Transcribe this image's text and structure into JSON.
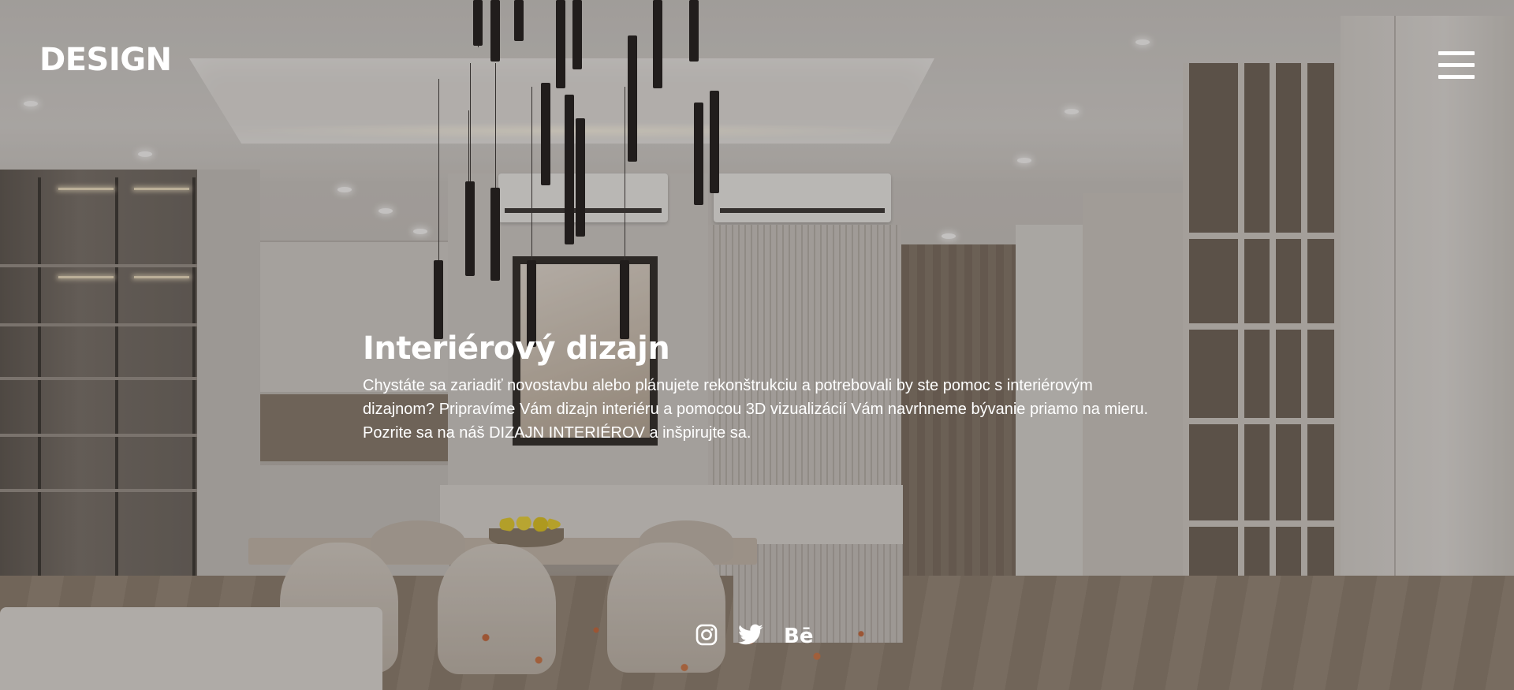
{
  "header": {
    "logo": "DESIGN",
    "menu_icon": "hamburger-menu-icon"
  },
  "hero": {
    "title": "Interiérový dizajn",
    "description": "Chystáte sa zariadiť novostavbu alebo plánujete rekonštrukciu a potrebovali by ste pomoc s interiérovým dizajnom? Pripravíme Vám dizajn interiéru a pomocou 3D vizualizácií Vám navrhneme bývanie priamo na mieru. Pozrite sa na náš DIZAJN INTERIÉROV a inšpirujte sa."
  },
  "social": {
    "items": [
      {
        "icon": "instagram-icon"
      },
      {
        "icon": "twitter-icon"
      },
      {
        "icon": "behance-icon",
        "label": "Bē"
      }
    ]
  },
  "colors": {
    "text": "#ffffff",
    "background_overlay": "#26221e"
  }
}
